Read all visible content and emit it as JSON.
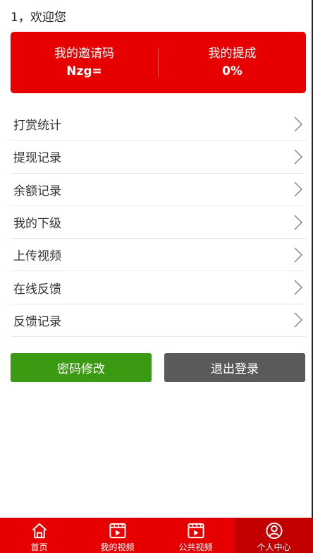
{
  "greeting": "1，欢迎您",
  "banner": {
    "invite_label": "我的邀请码",
    "invite_value": "Nzg=",
    "commission_label": "我的提成",
    "commission_value": "0%"
  },
  "menu": [
    {
      "label": "打赏统计"
    },
    {
      "label": "提现记录"
    },
    {
      "label": "余额记录"
    },
    {
      "label": "我的下级"
    },
    {
      "label": "上传视频"
    },
    {
      "label": "在线反馈"
    },
    {
      "label": "反馈记录"
    }
  ],
  "buttons": {
    "change_password": "密码修改",
    "logout": "退出登录"
  },
  "tabbar": [
    {
      "label": "首页",
      "icon": "home-icon"
    },
    {
      "label": "我的视频",
      "icon": "video-icon"
    },
    {
      "label": "公共视频",
      "icon": "video-icon"
    },
    {
      "label": "个人中心",
      "icon": "user-icon",
      "active": true
    }
  ],
  "colors": {
    "primary_red": "#e60000",
    "active_tab": "#c20000",
    "green": "#3a9b12",
    "gray": "#5a5a5a"
  }
}
